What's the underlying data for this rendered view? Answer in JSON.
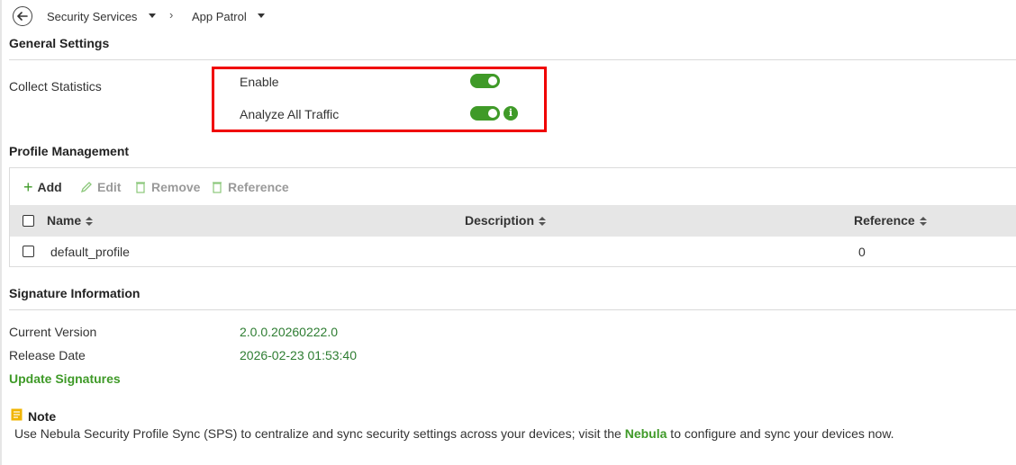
{
  "breadcrumb": {
    "items": [
      "Security Services",
      "App Patrol"
    ]
  },
  "general_settings": {
    "title": "General Settings",
    "collect_statistics_label": "Collect Statistics",
    "enable_label": "Enable",
    "enable_on": true,
    "analyze_label": "Analyze All Traffic",
    "analyze_on": true
  },
  "profile_management": {
    "title": "Profile Management",
    "toolbar": {
      "add": "Add",
      "edit": "Edit",
      "remove": "Remove",
      "reference": "Reference"
    },
    "columns": [
      "Name",
      "Description",
      "Reference"
    ],
    "rows": [
      {
        "name": "default_profile",
        "description": "",
        "reference": "0"
      }
    ]
  },
  "signature_information": {
    "title": "Signature Information",
    "current_version_label": "Current Version",
    "current_version": "2.0.0.20260222.0",
    "release_date_label": "Release Date",
    "release_date": "2026-02-23 01:53:40",
    "update_link": "Update Signatures"
  },
  "note": {
    "title": "Note",
    "text_before": "Use Nebula Security Profile Sync (SPS) to centralize and sync security settings across your devices; visit the ",
    "link": "Nebula",
    "text_after": " to configure and sync your devices now."
  },
  "colors": {
    "accent_green": "#3f9a28",
    "highlight_red": "#f00000",
    "header_gray": "#e6e6e6"
  }
}
